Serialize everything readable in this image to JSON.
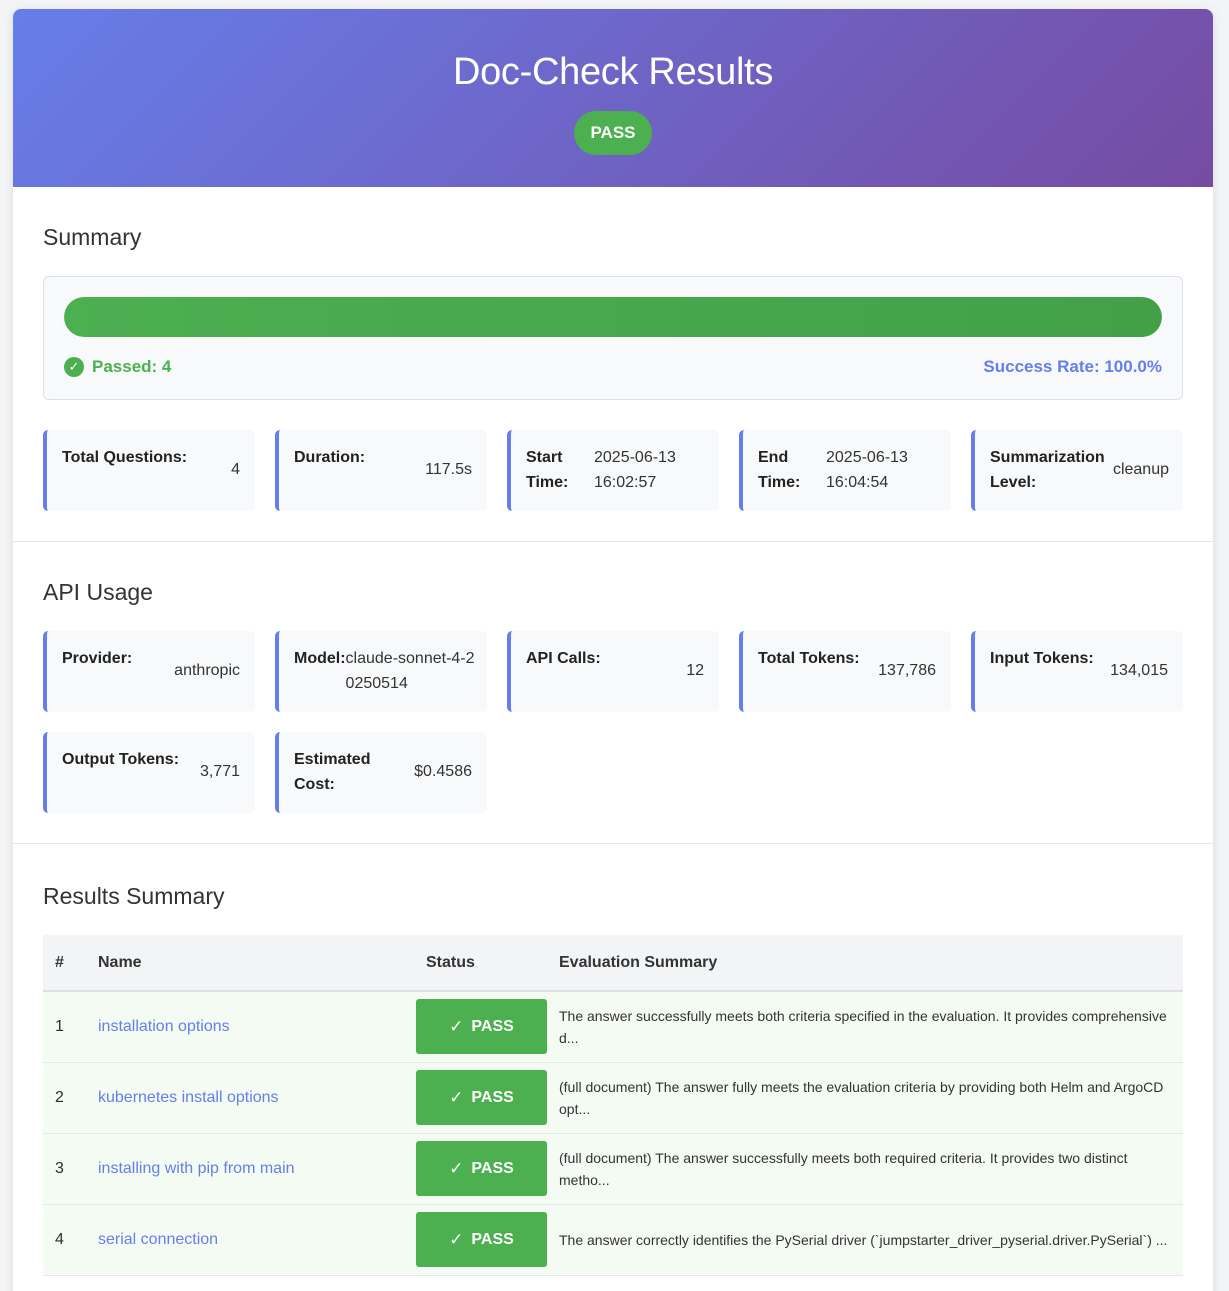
{
  "header": {
    "title": "Doc-Check Results",
    "status": "PASS"
  },
  "summary": {
    "heading": "Summary",
    "progress_fraction": 1.0,
    "passed_label": "Passed: 4",
    "success_rate": "Success Rate: 100.0%",
    "stats": [
      {
        "label": "Total Questions:",
        "value": "4"
      },
      {
        "label": "Duration:",
        "value": "117.5s"
      },
      {
        "label": "Start Time:",
        "value": "2025-06-13 16:02:57"
      },
      {
        "label": "End Time:",
        "value": "2025-06-13 16:04:54"
      },
      {
        "label": "Summarization Level:",
        "value": "cleanup"
      }
    ]
  },
  "api_usage": {
    "heading": "API Usage",
    "stats": [
      {
        "label": "Provider:",
        "value": "anthropic"
      },
      {
        "label": "Model:",
        "value": "claude-sonnet-4-20250514"
      },
      {
        "label": "API Calls:",
        "value": "12"
      },
      {
        "label": "Total Tokens:",
        "value": "137,786"
      },
      {
        "label": "Input Tokens:",
        "value": "134,015"
      },
      {
        "label": "Output Tokens:",
        "value": "3,771"
      },
      {
        "label": "Estimated Cost:",
        "value": "$0.4586"
      }
    ]
  },
  "results": {
    "heading": "Results Summary",
    "columns": [
      "#",
      "Name",
      "Status",
      "Evaluation Summary"
    ],
    "rows": [
      {
        "num": "1",
        "name": "installation options",
        "status": "PASS",
        "summary": "The answer successfully meets both criteria specified in the evaluation. It provides comprehensive d..."
      },
      {
        "num": "2",
        "name": "kubernetes install options",
        "status": "PASS",
        "summary": "(full document) The answer fully meets the evaluation criteria by providing both Helm and ArgoCD opt..."
      },
      {
        "num": "3",
        "name": "installing with pip from main",
        "status": "PASS",
        "summary": "(full document) The answer successfully meets both required criteria. It provides two distinct metho..."
      },
      {
        "num": "4",
        "name": "serial connection",
        "status": "PASS",
        "summary": "The answer correctly identifies the PySerial driver (`jumpstarter_driver_pyserial.driver.PySerial`) ..."
      }
    ]
  },
  "colors": {
    "accent": "#667eea",
    "accent_end": "#764ba2",
    "pass": "#4caf50"
  },
  "icons": {
    "passed": "check-circle-icon",
    "status": "checkmark-icon"
  }
}
